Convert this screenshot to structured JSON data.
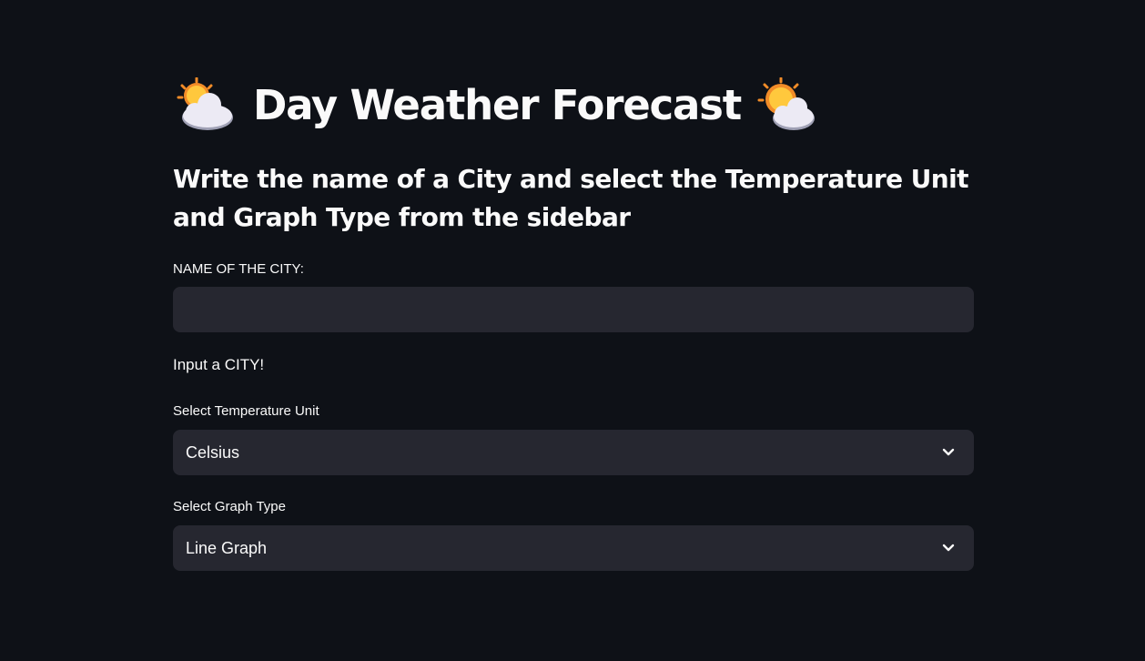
{
  "page": {
    "title": "Day Weather Forecast",
    "left_icon": "sun-behind-cloud-icon",
    "right_icon": "sun-behind-large-cloud-icon",
    "subtitle": "Write the name of a City and select the Temperature Unit and Graph Type from the sidebar"
  },
  "city_input": {
    "label": "NAME OF THE CITY:",
    "value": "",
    "placeholder": ""
  },
  "status_message": "Input a CITY!",
  "temperature_unit": {
    "label": "Select Temperature Unit",
    "selected": "Celsius",
    "icon": "chevron-down-icon"
  },
  "graph_type": {
    "label": "Select Graph Type",
    "selected": "Line Graph",
    "icon": "chevron-down-icon"
  },
  "colors": {
    "background": "#0e1117",
    "widget_background": "#262730",
    "text": "#fafafa",
    "sun": "#f5a623",
    "cloud": "#eceaf4"
  }
}
